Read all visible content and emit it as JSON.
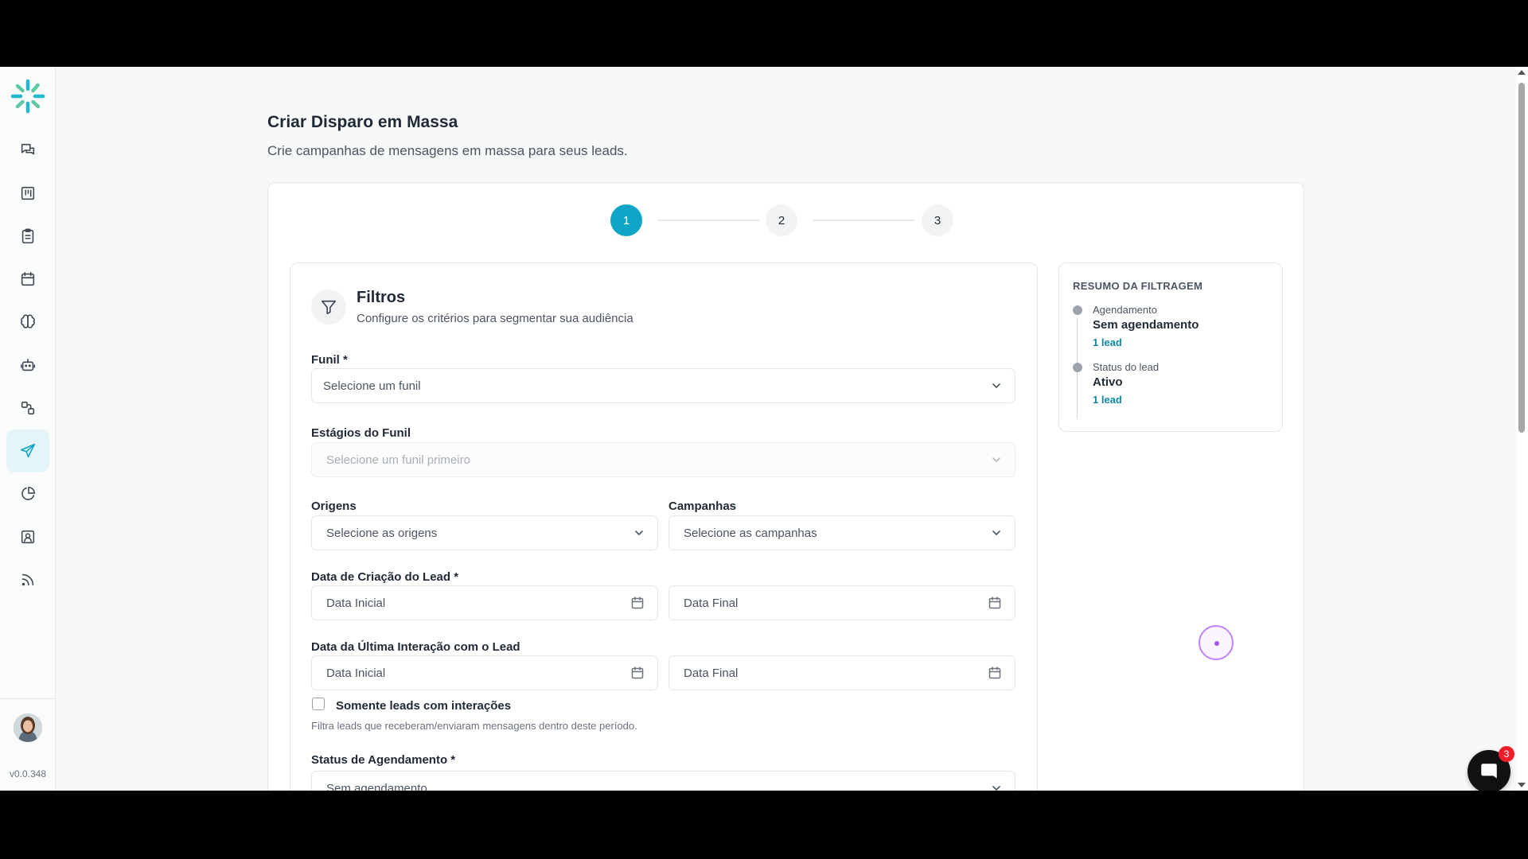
{
  "page": {
    "title": "Criar Disparo em Massa",
    "subtitle": "Crie campanhas de mensagens em massa para seus leads."
  },
  "stepper": {
    "steps": [
      {
        "label": "1",
        "state": "active"
      },
      {
        "label": "2",
        "state": "idle"
      },
      {
        "label": "3",
        "state": "idle"
      }
    ]
  },
  "filters": {
    "title": "Filtros",
    "subtitle": "Configure os critérios para segmentar sua audiência",
    "funnel": {
      "label": "Funil *",
      "placeholder": "Selecione um funil"
    },
    "stages": {
      "label": "Estágios do Funil",
      "placeholder": "Selecione um funil primeiro"
    },
    "origins": {
      "label": "Origens",
      "placeholder": "Selecione as origens"
    },
    "campaigns": {
      "label": "Campanhas",
      "placeholder": "Selecione as campanhas"
    },
    "created_date": {
      "label": "Data de Criação do Lead *",
      "start_placeholder": "Data Inicial",
      "end_placeholder": "Data Final"
    },
    "last_interaction": {
      "label": "Data da Última Interação com o Lead",
      "start_placeholder": "Data Inicial",
      "end_placeholder": "Data Final"
    },
    "only_interactions": {
      "label": "Somente leads com interações",
      "checked": false,
      "helper": "Filtra leads que receberam/enviaram mensagens dentro deste período."
    },
    "schedule_status": {
      "label": "Status de Agendamento *",
      "value": "Sem agendamento"
    }
  },
  "summary": {
    "title": "RESUMO DA FILTRAGEM",
    "items": [
      {
        "label": "Agendamento",
        "value": "Sem agendamento",
        "count": "1 lead"
      },
      {
        "label": "Status do lead",
        "value": "Ativo",
        "count": "1 lead"
      }
    ]
  },
  "sidebar": {
    "items": [
      {
        "icon": "chat-icon"
      },
      {
        "icon": "kanban-icon"
      },
      {
        "icon": "clipboard-icon"
      },
      {
        "icon": "calendar-icon"
      },
      {
        "icon": "brain-icon"
      },
      {
        "icon": "bot-icon"
      },
      {
        "icon": "workflow-icon"
      },
      {
        "icon": "send-icon",
        "active": true
      },
      {
        "icon": "pie-chart-icon"
      },
      {
        "icon": "contact-icon"
      },
      {
        "icon": "rss-icon"
      }
    ],
    "version": "v0.0.348"
  },
  "chat_widget": {
    "badge": "3"
  },
  "colors": {
    "accent": "#0ea5c6",
    "badge": "#ef1c2a",
    "link": "#0e8aa6"
  }
}
